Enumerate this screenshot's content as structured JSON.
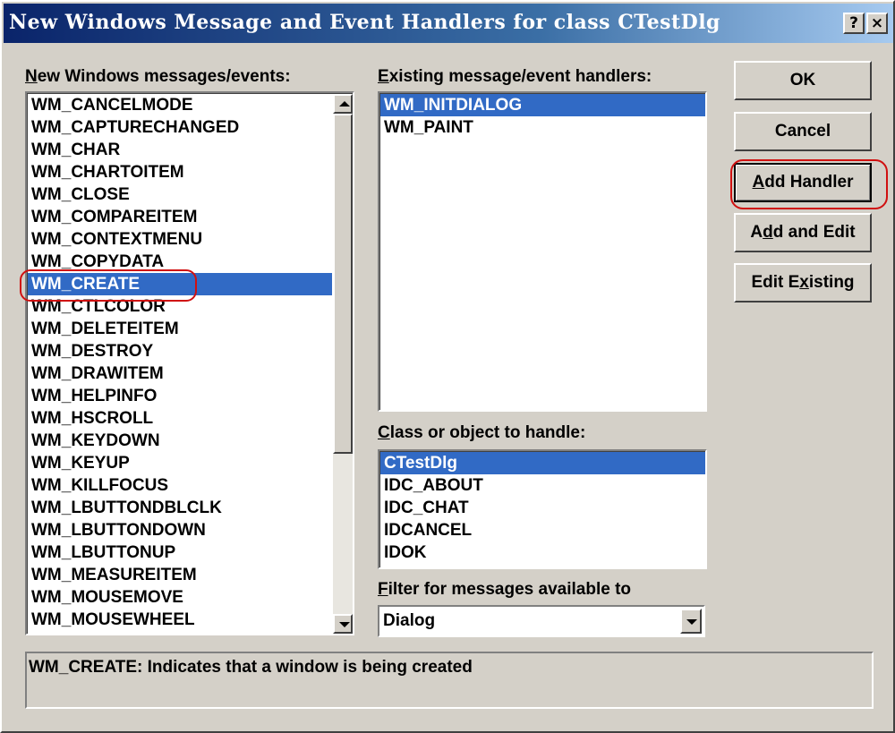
{
  "window": {
    "title": "New Windows Message and Event Handlers for class CTestDlg",
    "help_button": "?",
    "close_button": "×"
  },
  "left_panel": {
    "label_prefix": "",
    "label_hotkey": "N",
    "label_rest": "ew Windows messages/events:",
    "items": [
      "WM_CANCELMODE",
      "WM_CAPTURECHANGED",
      "WM_CHAR",
      "WM_CHARTOITEM",
      "WM_CLOSE",
      "WM_COMPAREITEM",
      "WM_CONTEXTMENU",
      "WM_COPYDATA",
      "WM_CREATE",
      "WM_CTLCOLOR",
      "WM_DELETEITEM",
      "WM_DESTROY",
      "WM_DRAWITEM",
      "WM_HELPINFO",
      "WM_HSCROLL",
      "WM_KEYDOWN",
      "WM_KEYUP",
      "WM_KILLFOCUS",
      "WM_LBUTTONDBLCLK",
      "WM_LBUTTONDOWN",
      "WM_LBUTTONUP",
      "WM_MEASUREITEM",
      "WM_MOUSEMOVE",
      "WM_MOUSEWHEEL"
    ],
    "selected_index": 8
  },
  "existing_panel": {
    "label_hotkey": "E",
    "label_rest": "xisting message/event handlers:",
    "items": [
      "WM_INITDIALOG",
      "WM_PAINT"
    ],
    "selected_index": 0
  },
  "class_panel": {
    "label_hotkey": "C",
    "label_rest": "lass or object to handle:",
    "items": [
      "CTestDlg",
      "IDC_ABOUT",
      "IDC_CHAT",
      "IDCANCEL",
      "IDOK"
    ],
    "selected_index": 0
  },
  "filter": {
    "label_hotkey": "F",
    "label_rest": "ilter for messages available to",
    "value": "Dialog"
  },
  "buttons": {
    "ok": "OK",
    "cancel": "Cancel",
    "add_handler_hotkey": "A",
    "add_handler_rest": "dd Handler",
    "add_edit_pre": "A",
    "add_edit_hotkey": "d",
    "add_edit_rest": "d and Edit",
    "edit_existing_pre": "Edit E",
    "edit_existing_hotkey": "x",
    "edit_existing_rest": "isting"
  },
  "description": "WM_CREATE:  Indicates that a window is being created",
  "colors": {
    "selection": "#316ac5",
    "annotation": "#d01010",
    "title_start": "#0a246a",
    "title_end": "#a6caf0"
  }
}
